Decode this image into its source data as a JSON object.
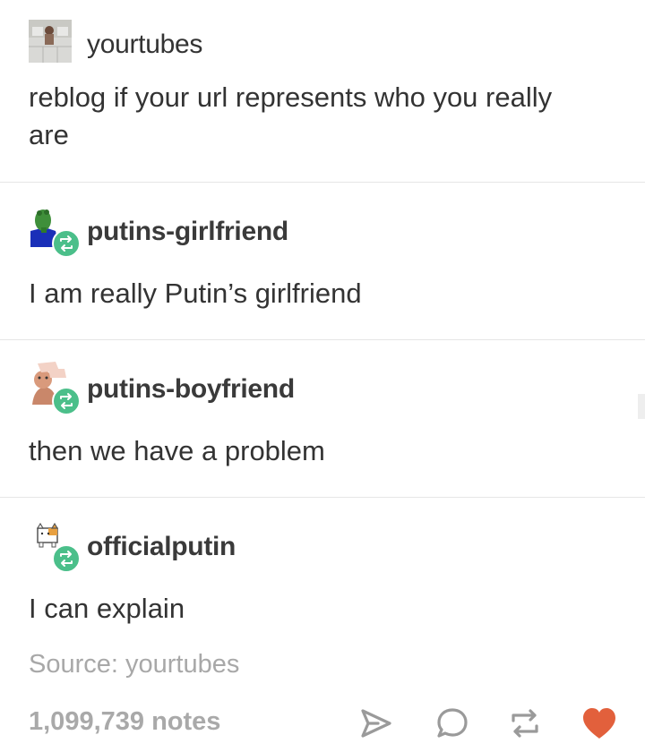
{
  "posts": [
    {
      "username": "yourtubes",
      "text": "reblog if your url represents who you really are",
      "avatar_icon": "photo-avatar-icon",
      "reblogged": false
    },
    {
      "username": "putins-girlfriend",
      "text": "I am really Putin’s girlfriend",
      "avatar_icon": "frog-avatar-icon",
      "reblogged": true
    },
    {
      "username": "putins-boyfriend",
      "text": "then we have a problem",
      "avatar_icon": "sticker-avatar-icon",
      "reblogged": true
    },
    {
      "username": "officialputin",
      "text": "I can explain",
      "avatar_icon": "cat-avatar-icon",
      "reblogged": true
    }
  ],
  "source": {
    "label": "Source: ",
    "name": "yourtubes"
  },
  "footer": {
    "notes": "1,099,739 notes",
    "icons": [
      "share-icon",
      "reply-icon",
      "reblog-icon",
      "like-icon"
    ]
  },
  "colors": {
    "reblog_badge": "#4bbf8a",
    "like": "#e2603c",
    "muted_text": "#a8a8a8",
    "divider": "#e6e6e6"
  }
}
